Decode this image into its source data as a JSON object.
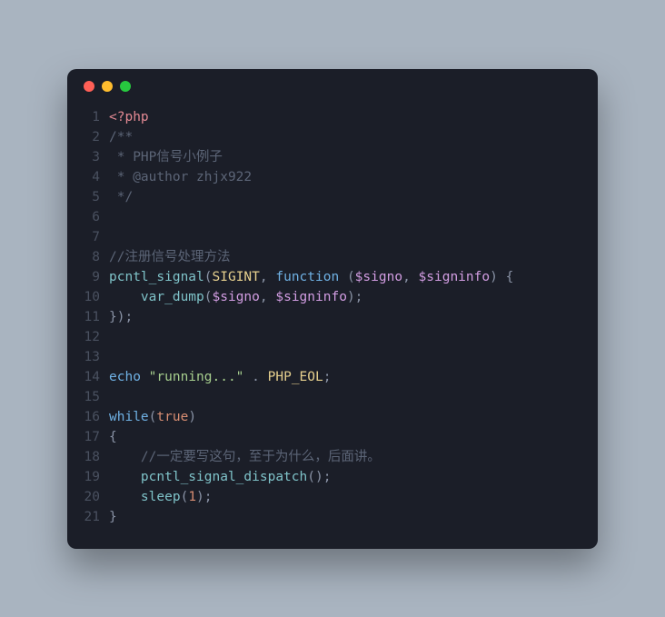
{
  "colors": {
    "window_bg": "#1b1e28",
    "page_bg": "#a9b4c0",
    "close": "#ff5f56",
    "minimize": "#ffbd2e",
    "zoom": "#27c93f"
  },
  "code": {
    "lines": [
      {
        "n": "1",
        "tokens": [
          {
            "cls": "c-tag",
            "t": "<?php"
          }
        ]
      },
      {
        "n": "2",
        "tokens": [
          {
            "cls": "c-comment",
            "t": "/**"
          }
        ]
      },
      {
        "n": "3",
        "tokens": [
          {
            "cls": "c-comment",
            "t": " * PHP信号小例子"
          }
        ]
      },
      {
        "n": "4",
        "tokens": [
          {
            "cls": "c-comment",
            "t": " * @author zhjx922"
          }
        ]
      },
      {
        "n": "5",
        "tokens": [
          {
            "cls": "c-comment",
            "t": " */"
          }
        ]
      },
      {
        "n": "6",
        "tokens": []
      },
      {
        "n": "7",
        "tokens": []
      },
      {
        "n": "8",
        "tokens": [
          {
            "cls": "c-comment",
            "t": "//注册信号处理方法"
          }
        ]
      },
      {
        "n": "9",
        "tokens": [
          {
            "cls": "c-func",
            "t": "pcntl_signal"
          },
          {
            "cls": "c-punct",
            "t": "("
          },
          {
            "cls": "c-const",
            "t": "SIGINT"
          },
          {
            "cls": "c-punct",
            "t": ", "
          },
          {
            "cls": "c-keyword",
            "t": "function"
          },
          {
            "cls": "c-default",
            "t": " "
          },
          {
            "cls": "c-punct",
            "t": "("
          },
          {
            "cls": "c-var",
            "t": "$signo"
          },
          {
            "cls": "c-punct",
            "t": ", "
          },
          {
            "cls": "c-var",
            "t": "$signinfo"
          },
          {
            "cls": "c-punct",
            "t": ") {"
          }
        ]
      },
      {
        "n": "10",
        "tokens": [
          {
            "cls": "c-default",
            "t": "    "
          },
          {
            "cls": "c-func",
            "t": "var_dump"
          },
          {
            "cls": "c-punct",
            "t": "("
          },
          {
            "cls": "c-var",
            "t": "$signo"
          },
          {
            "cls": "c-punct",
            "t": ", "
          },
          {
            "cls": "c-var",
            "t": "$signinfo"
          },
          {
            "cls": "c-punct",
            "t": ");"
          }
        ]
      },
      {
        "n": "11",
        "tokens": [
          {
            "cls": "c-punct",
            "t": "});"
          }
        ]
      },
      {
        "n": "12",
        "tokens": []
      },
      {
        "n": "13",
        "tokens": []
      },
      {
        "n": "14",
        "tokens": [
          {
            "cls": "c-keyword",
            "t": "echo"
          },
          {
            "cls": "c-default",
            "t": " "
          },
          {
            "cls": "c-string",
            "t": "\"running...\""
          },
          {
            "cls": "c-default",
            "t": " "
          },
          {
            "cls": "c-punct",
            "t": "."
          },
          {
            "cls": "c-default",
            "t": " "
          },
          {
            "cls": "c-const",
            "t": "PHP_EOL"
          },
          {
            "cls": "c-punct",
            "t": ";"
          }
        ]
      },
      {
        "n": "15",
        "tokens": []
      },
      {
        "n": "16",
        "tokens": [
          {
            "cls": "c-keyword",
            "t": "while"
          },
          {
            "cls": "c-punct",
            "t": "("
          },
          {
            "cls": "c-bool",
            "t": "true"
          },
          {
            "cls": "c-punct",
            "t": ")"
          }
        ]
      },
      {
        "n": "17",
        "tokens": [
          {
            "cls": "c-punct",
            "t": "{"
          }
        ]
      },
      {
        "n": "18",
        "tokens": [
          {
            "cls": "c-default",
            "t": "    "
          },
          {
            "cls": "c-comment",
            "t": "//一定要写这句，至于为什么，后面讲。"
          }
        ]
      },
      {
        "n": "19",
        "tokens": [
          {
            "cls": "c-default",
            "t": "    "
          },
          {
            "cls": "c-func",
            "t": "pcntl_signal_dispatch"
          },
          {
            "cls": "c-punct",
            "t": "();"
          }
        ]
      },
      {
        "n": "20",
        "tokens": [
          {
            "cls": "c-default",
            "t": "    "
          },
          {
            "cls": "c-func",
            "t": "sleep"
          },
          {
            "cls": "c-punct",
            "t": "("
          },
          {
            "cls": "c-number",
            "t": "1"
          },
          {
            "cls": "c-punct",
            "t": ");"
          }
        ]
      },
      {
        "n": "21",
        "tokens": [
          {
            "cls": "c-punct",
            "t": "}"
          }
        ]
      }
    ]
  }
}
